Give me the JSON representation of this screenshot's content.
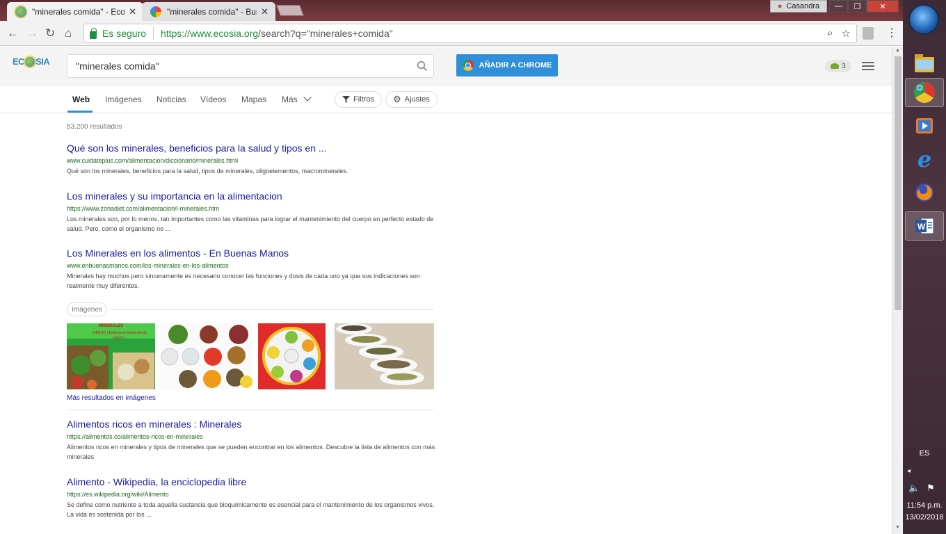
{
  "browser": {
    "tabs": [
      {
        "title": "\"minerales comida\" - Eco",
        "active": true
      },
      {
        "title": "\"minerales comida\" - Bus",
        "active": false
      }
    ],
    "user": "Casandra",
    "secure_label": "Es seguro",
    "url_host": "https://www.ecosia.org",
    "url_path": "/search?q=\"minerales+comida\""
  },
  "ecosia": {
    "logo_left": "EC",
    "logo_right": "SIA",
    "search_value": "\"minerales comida\"",
    "add_chrome_label": "AÑADIR A CHROME",
    "tree_count": "3",
    "tabs": [
      "Web",
      "Imágenes",
      "Noticias",
      "Vídeos",
      "Mapas",
      "Más"
    ],
    "filters_label": "Filtros",
    "settings_label": "Ajustes",
    "results_count": "53.200 resultados",
    "results": [
      {
        "title": "Qué son los minerales, beneficios para la salud y tipos en ...",
        "url": "www.cuidateplus.com/alimentacion/diccionario/minerales.html",
        "desc": "Qué son los minerales, beneficios para la salud, tipos de minerales, oligoelementos, macrominerales."
      },
      {
        "title": "Los minerales y su importancia en la alimentacion",
        "url": "https://www.zonadiet.com/alimentacion/l-minerales.htm",
        "desc": "Los minerales son, por lo menos, tan importantes como las vitaminas para lograr el mantenimiento del cuerpo en perfecto estado de salud. Pero, como el organismo no ..."
      },
      {
        "title": "Los Minerales en los alimentos - En Buenas Manos",
        "url": "www.enbuenasmanos.com/los-minerales-en-los-alimentos",
        "desc": "Minerales hay muchos pero sinceramente es necesario conocer las funciones y dosis de cada uno ya que sus indicaciones son realmente muy diferentes."
      },
      {
        "title": "Alimentos ricos en minerales : Minerales",
        "url": "https://alimentos.co/alimentos-ricos-en-minerales",
        "desc": "Alimentos ricos en minerales y tipos de minerales que se pueden encontrar en los alimentos. Descubre la lista de alimentos con más minerales"
      },
      {
        "title": "Alimento - Wikipedia, la enciclopedia libre",
        "url": "https://es.wikipedia.org/wiki/Alimento",
        "desc": "Se define como nutriente a toda aquella sustancia que bioquímicamente es esencial para el mantenimiento de los organismos vivos. La vida es sostenida por los ..."
      }
    ],
    "images_label": "Imágenes",
    "image1_text": "MINERALES",
    "image1_sub": "HIERRO ( Estimula la formación de sangre ).",
    "more_images": "Más resultados en imágenes"
  },
  "taskbar": {
    "lang": "ES",
    "time": "11:54 p.m.",
    "date": "13/02/2018"
  }
}
